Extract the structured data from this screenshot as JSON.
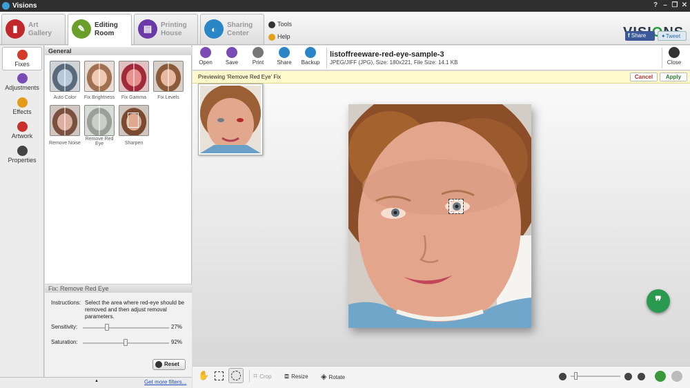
{
  "window": {
    "title": "Visions",
    "controls": [
      "?",
      "–",
      "❐",
      "✕"
    ]
  },
  "tabs": [
    {
      "line1": "Art",
      "line2": "Gallery",
      "color": "#c0282d",
      "icon": "art-gallery-icon"
    },
    {
      "line1": "Editing",
      "line2": "Room",
      "color": "#6aa02a",
      "icon": "editing-room-icon"
    },
    {
      "line1": "Printing",
      "line2": "House",
      "color": "#6b3aa8",
      "icon": "printing-house-icon"
    },
    {
      "line1": "Sharing",
      "line2": "Center",
      "color": "#2b86c8",
      "icon": "sharing-center-icon"
    }
  ],
  "mini_menu": {
    "tools": "Tools",
    "help": "Help"
  },
  "brand": {
    "logo_left": "VISI",
    "logo_o": "O",
    "logo_right": "NS",
    "share": "Share",
    "tweet": "Tweet"
  },
  "leftnav": [
    {
      "label": "Fixes",
      "color": "#d23a2a"
    },
    {
      "label": "Adjustments",
      "color": "#7a4bb5"
    },
    {
      "label": "Effects",
      "color": "#e59b1a"
    },
    {
      "label": "Artwork",
      "color": "#c9302c"
    },
    {
      "label": "Properties",
      "color": "#444444"
    }
  ],
  "panel": {
    "header": "General",
    "filters": [
      "Auto Color",
      "Fix Brightness",
      "Fix Gamma",
      "Fix Levels",
      "Remove Noise",
      "Remove Red Eye",
      "Sharpen"
    ],
    "fix": {
      "header": "Fix: Remove Red Eye",
      "instructions_label": "Instructions:",
      "instructions_text": "Select the area where red-eye should be removed and then adjust removal parameters.",
      "sensitivity_label": "Sensitivity:",
      "sensitivity_value": "27%",
      "sensitivity": 0.27,
      "saturation_label": "Saturation:",
      "saturation_value": "92%",
      "saturation": 0.92,
      "reset": "Reset"
    },
    "more_link": "Get more filters...",
    "scroll_marker": "▲"
  },
  "toolbar": {
    "buttons": [
      {
        "label": "Open",
        "color": "#7a4bb5"
      },
      {
        "label": "Save",
        "color": "#7a4bb5"
      },
      {
        "label": "Print",
        "color": "#777777"
      },
      {
        "label": "Share",
        "color": "#2b86c8"
      },
      {
        "label": "Backup",
        "color": "#2b86c8"
      }
    ],
    "file_name": "listoffreeware-red-eye-sample-3",
    "file_info": "JPEG/JIFF (JPG), Size: 180x221, File Size: 14.1 KB",
    "close": "Close"
  },
  "notice": {
    "text": "Previewing 'Remove Red Eye' Fix",
    "cancel": "Cancel",
    "apply": "Apply"
  },
  "bottom": {
    "crop": "Crop",
    "resize": "Resize",
    "rotate": "Rotate"
  },
  "accent": {
    "green": "#2a9a50",
    "cancel": "#b03030"
  }
}
